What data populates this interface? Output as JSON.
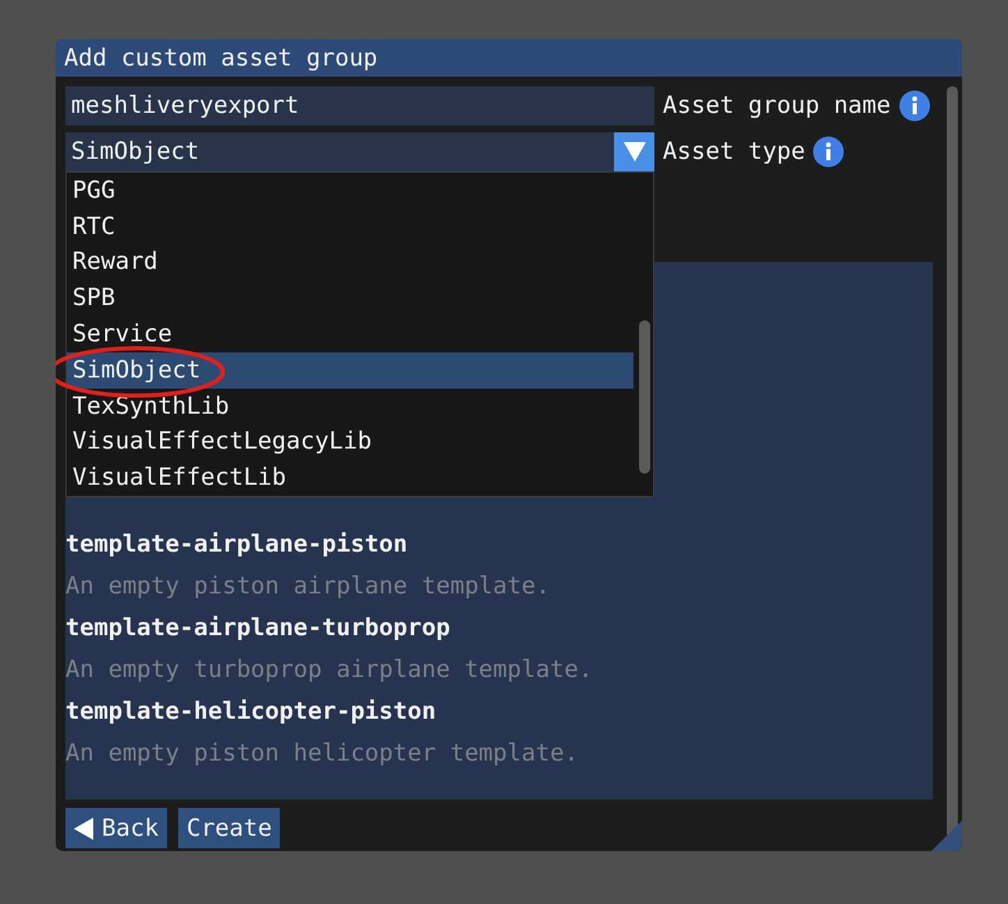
{
  "window": {
    "title": "Add custom asset group"
  },
  "name_field": {
    "value": "meshliveryexport",
    "label": "Asset group name"
  },
  "type_combo": {
    "value": "SimObject",
    "label": "Asset type",
    "expanded": true
  },
  "dropdown_items": [
    {
      "label": "PGG",
      "selected": false
    },
    {
      "label": "RTC",
      "selected": false
    },
    {
      "label": "Reward",
      "selected": false
    },
    {
      "label": "SPB",
      "selected": false
    },
    {
      "label": "Service",
      "selected": false
    },
    {
      "label": "SimObject",
      "selected": true
    },
    {
      "label": "TexSynthLib",
      "selected": false
    },
    {
      "label": "VisualEffectLegacyLib",
      "selected": false
    },
    {
      "label": "VisualEffectLib",
      "selected": false
    }
  ],
  "templates": [
    {
      "name": "template-airplane-piston",
      "description": "An empty piston airplane template."
    },
    {
      "name": "template-airplane-turboprop",
      "description": "An empty turboprop airplane template."
    },
    {
      "name": "template-helicopter-piston",
      "description": "An empty piston helicopter template."
    }
  ],
  "buttons": [
    {
      "kind": "back",
      "label": "Back"
    },
    {
      "kind": "plain",
      "label": "Create"
    }
  ]
}
